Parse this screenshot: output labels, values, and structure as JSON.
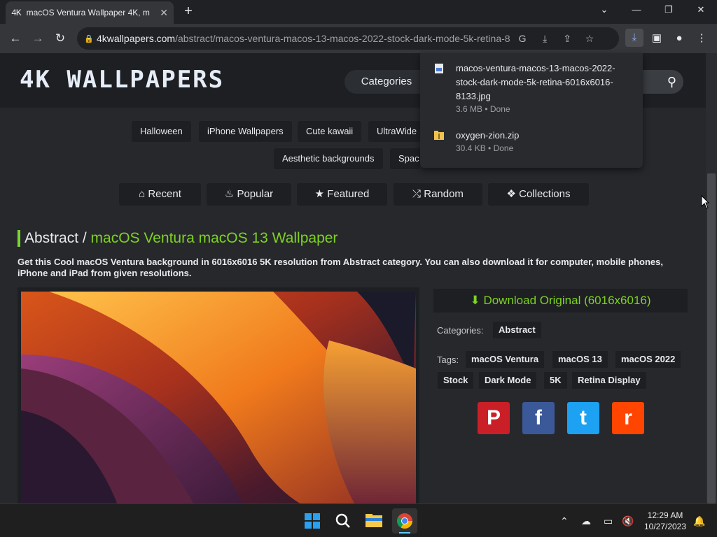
{
  "browser": {
    "tab_title": "macOS Ventura Wallpaper 4K, m",
    "tab_favicon": "4K",
    "url_host": "4kwallpapers.com",
    "url_path": "/abstract/macos-ventura-macos-13-macos-2022-stock-dark-mode-5k-retina-8...",
    "icons": [
      "back-icon",
      "forward-icon",
      "reload-icon",
      "lock-icon",
      "google-lens-icon",
      "install-icon",
      "share-icon",
      "star-icon",
      "download-icon",
      "side-panel-icon",
      "profile-icon",
      "menu-icon"
    ]
  },
  "downloads": [
    {
      "name": "macos-ventura-macos-13-macos-2022-stock-dark-mode-5k-retina-6016x6016-8133.jpg",
      "meta": "3.6 MB • Done"
    },
    {
      "name": "oxygen-zion.zip",
      "meta": "30.4 KB • Done"
    }
  ],
  "site": {
    "logo": "4K WALLPAPERS",
    "categories_label": "Categories",
    "chips_row1": [
      "Halloween",
      "iPhone Wallpapers",
      "Cute kawaii",
      "UltraWide l"
    ],
    "chips_row2": [
      "Aesthetic backgrounds",
      "Spac"
    ],
    "nav": [
      {
        "label": "Recent",
        "icon": "home-icon"
      },
      {
        "label": "Popular",
        "icon": "fire-icon"
      },
      {
        "label": "Featured",
        "icon": "star-icon"
      },
      {
        "label": "Random",
        "icon": "shuffle-icon"
      },
      {
        "label": "Collections",
        "icon": "cubes-icon"
      }
    ],
    "heading_prefix": "Abstract /",
    "heading_highlight": "macOS Ventura macOS 13 Wallpaper",
    "description": "Get this Cool macOS Ventura background in 6016x6016 5K resolution from Abstract category. You can also download it for computer, mobile phones, iPhone and iPad from given resolutions.",
    "download_label": "Download Original (6016x6016)",
    "categories_prefix": "Categories:",
    "category": "Abstract",
    "tags_prefix": "Tags:",
    "tags": [
      "macOS Ventura",
      "macOS 13",
      "macOS 2022",
      "Stock",
      "Dark Mode",
      "5K",
      "Retina Display"
    ],
    "social": [
      {
        "name": "pinterest",
        "glyph": "P",
        "color": "#cb1f27"
      },
      {
        "name": "facebook",
        "glyph": "f",
        "color": "#3b5998"
      },
      {
        "name": "twitter",
        "glyph": "t",
        "color": "#1da1f2"
      },
      {
        "name": "reddit",
        "glyph": "r",
        "color": "#ff4500"
      }
    ],
    "accent_color": "#7ed321"
  },
  "taskbar": {
    "time": "12:29 AM",
    "date": "10/27/2023"
  }
}
